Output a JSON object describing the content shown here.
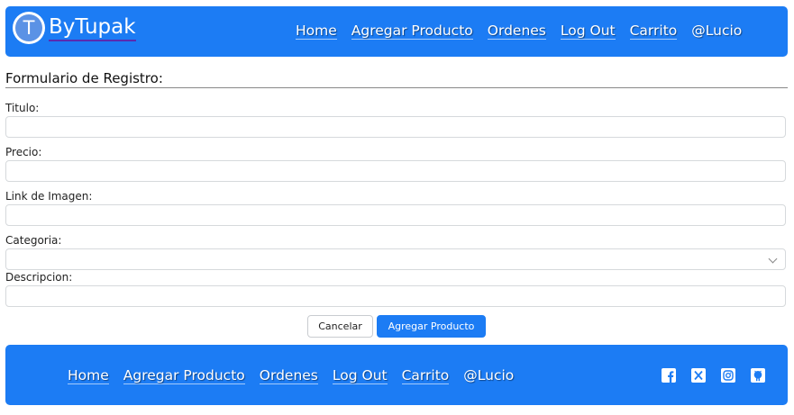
{
  "header": {
    "brand_initial": "T",
    "brand_name": "ByTupak",
    "nav": [
      "Home",
      "Agregar Producto",
      "Ordenes",
      "Log Out",
      "Carrito",
      "@Lucio"
    ]
  },
  "form": {
    "title": "Formulario de Registro:",
    "fields": {
      "titulo": {
        "label": "Titulo:",
        "value": ""
      },
      "precio": {
        "label": "Precio:",
        "value": ""
      },
      "imagen": {
        "label": "Link de Imagen:",
        "value": ""
      },
      "categoria": {
        "label": "Categoria:",
        "value": ""
      },
      "descripcion": {
        "label": "Descripcion:",
        "value": ""
      }
    },
    "cancel_label": "Cancelar",
    "submit_label": "Agregar Producto"
  },
  "footer": {
    "nav": [
      "Home",
      "Agregar Producto",
      "Ordenes",
      "Log Out",
      "Carrito",
      "@Lucio"
    ],
    "social_icons": [
      "facebook-icon",
      "x-icon",
      "instagram-icon",
      "github-icon"
    ]
  },
  "colors": {
    "primary": "#1c7cf4",
    "logo_inner": "#5b92e5",
    "white": "#ffffff"
  }
}
